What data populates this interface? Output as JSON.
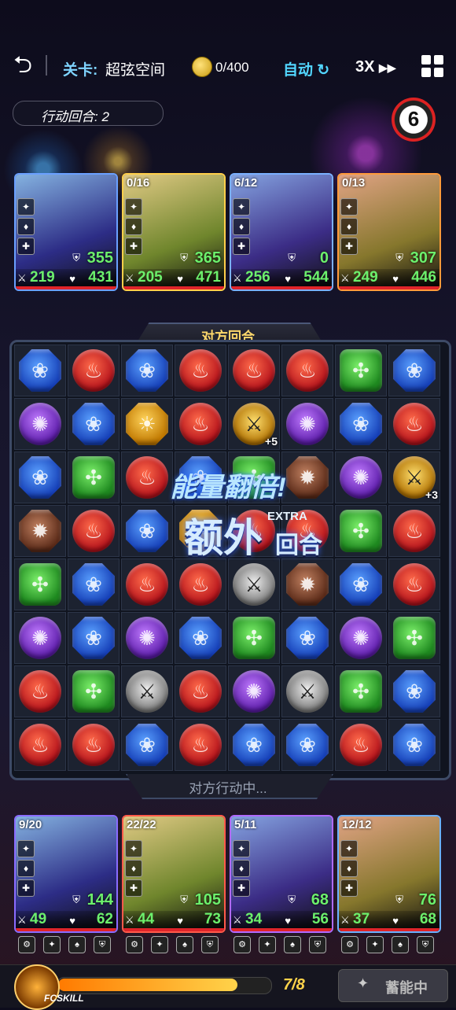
{
  "topbar": {
    "back_icon": "back-arrow-icon",
    "stage_label": "关卡:",
    "stage_name": "超弦空间",
    "coin_count": "0/400",
    "auto_label": "自动",
    "speed_label": "3X",
    "menu_icon": "grid-menu-icon"
  },
  "turn": {
    "label": "行动回合: 2",
    "timer": "6"
  },
  "enemy_cards": [
    {
      "count": "",
      "shield": "355",
      "attack": "219",
      "hp": "431",
      "border": "#6aa0ff"
    },
    {
      "count": "0/16",
      "shield": "365",
      "attack": "205",
      "hp": "471",
      "border": "#ffcf4a"
    },
    {
      "count": "6/12",
      "shield": "0",
      "attack": "256",
      "hp": "544",
      "border": "#7ab0ff"
    },
    {
      "count": "0/13",
      "shield": "307",
      "attack": "249",
      "hp": "446",
      "border": "#ff9a3a"
    }
  ],
  "board": {
    "tab_label": "对方回合",
    "status": "对方行动中...",
    "banner_top": "能量翻倍!",
    "banner_main": "额外",
    "banner_extra": "EXTRA",
    "banner_sub": "回合",
    "rows": [
      [
        "blue",
        "red",
        "blue",
        "red",
        "red",
        "red",
        "green",
        "blue"
      ],
      [
        "purple",
        "blue",
        "gold",
        "red",
        "gsword",
        "purple",
        "blue",
        "red"
      ],
      [
        "blue",
        "green",
        "red",
        "blue",
        "green",
        "brown",
        "purple",
        "gsword"
      ],
      [
        "brown",
        "red",
        "blue",
        "gold",
        "red",
        "red",
        "green",
        "red"
      ],
      [
        "green",
        "blue",
        "red",
        "red",
        "sword",
        "brown",
        "blue",
        "red"
      ],
      [
        "purple",
        "blue",
        "purple",
        "blue",
        "green",
        "blue",
        "purple",
        "green"
      ],
      [
        "red",
        "green",
        "sword",
        "red",
        "purple",
        "sword",
        "green",
        "blue"
      ],
      [
        "red",
        "red",
        "blue",
        "red",
        "blue",
        "blue",
        "red",
        "blue"
      ]
    ],
    "bonuses": {
      "1-4": "+5",
      "2-7": "+3"
    }
  },
  "player_cards": [
    {
      "count": "9/20",
      "shield": "144",
      "attack": "49",
      "hp": "62",
      "border": "#8a6cff"
    },
    {
      "count": "22/22",
      "shield": "105",
      "attack": "44",
      "hp": "73",
      "border": "#ff5a4a"
    },
    {
      "count": "5/11",
      "shield": "68",
      "attack": "34",
      "hp": "56",
      "border": "#b06aff"
    },
    {
      "count": "12/12",
      "shield": "76",
      "attack": "37",
      "hp": "68",
      "border": "#6ab0ff"
    }
  ],
  "bottom": {
    "skill_label": "FCSKILL",
    "energy_text": "7/8",
    "energy_fraction": 0.85,
    "charge_label": "蓄能中"
  }
}
